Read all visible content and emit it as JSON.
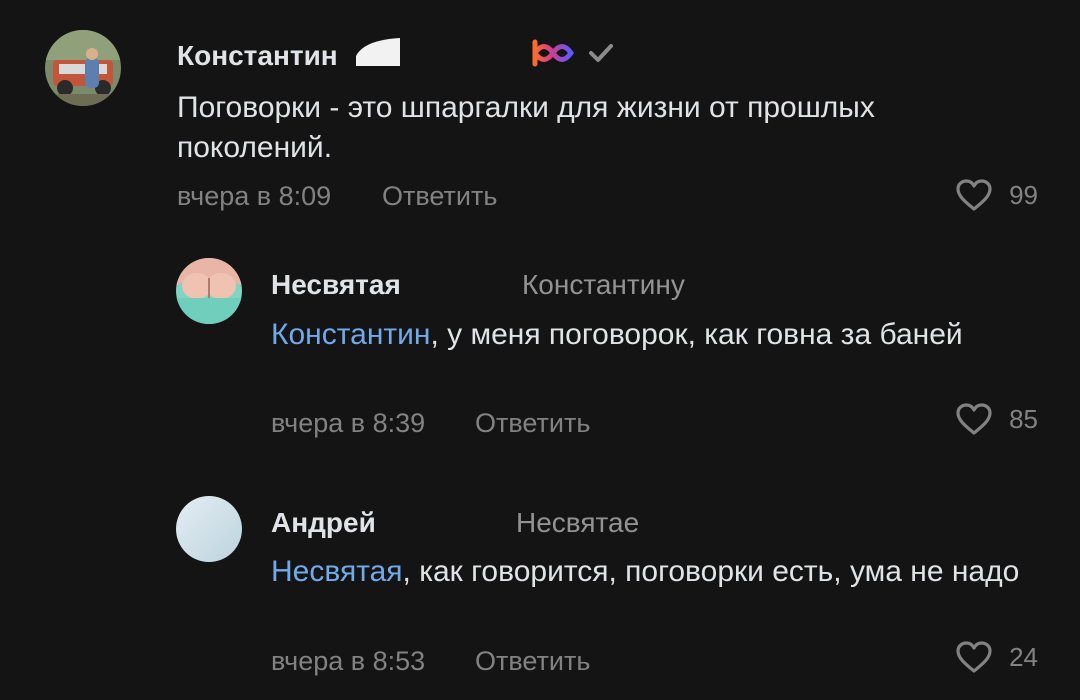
{
  "comments": [
    {
      "author": "Константин",
      "text": "Поговорки - это шпаргалки для жизни от прошлых поколений.",
      "time": "вчера в 8:09",
      "reply_label": "Ответить",
      "likes": "99"
    },
    {
      "author": "Несвятая",
      "reply_to": "Константину",
      "mention": "Константин",
      "text": ", у меня поговорок, как говна за баней",
      "time": "вчера в 8:39",
      "reply_label": "Ответить",
      "likes": "85"
    },
    {
      "author": "Андрей",
      "reply_to": "Несвятае",
      "mention": "Несвятая",
      "text": ", как говорится, поговорки есть, ума не надо",
      "time": "вчера в 8:53",
      "reply_label": "Ответить",
      "likes": "24"
    }
  ],
  "colors": {
    "background": "#141414",
    "mention": "#71aaeb",
    "secondary_text": "#828282",
    "primary_text": "#e1e3e6"
  }
}
